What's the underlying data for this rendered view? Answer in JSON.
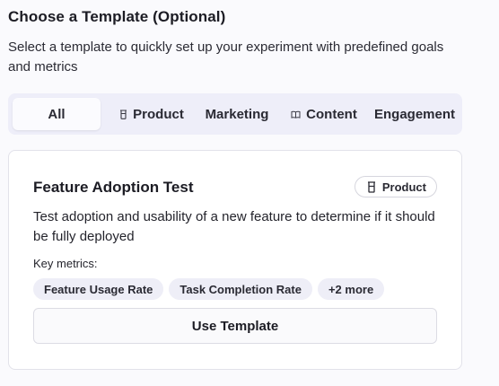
{
  "header": {
    "title": "Choose a Template (Optional)",
    "subtitle": "Select a template to quickly set up your experiment with predefined goals and metrics"
  },
  "tabs": [
    {
      "label": "All",
      "icon": null,
      "active": true
    },
    {
      "label": "Product",
      "icon": "beaker-icon",
      "active": false
    },
    {
      "label": "Marketing",
      "icon": null,
      "active": false
    },
    {
      "label": "Content",
      "icon": "book-icon",
      "active": false
    },
    {
      "label": "Engagement",
      "icon": null,
      "active": false
    }
  ],
  "card": {
    "title": "Feature Adoption Test",
    "badge": {
      "label": "Product",
      "icon": "beaker-icon"
    },
    "description": "Test adoption and usability of a new feature to determine if it should be fully deployed",
    "metrics_label": "Key metrics:",
    "metrics": [
      "Feature Usage Rate",
      "Task Completion Rate",
      "+2 more"
    ],
    "button_label": "Use Template"
  },
  "colors": {
    "background": "#fafafd",
    "tab_bar": "#eeeef9",
    "chip": "#eeeef7",
    "text": "#1c1c24"
  }
}
